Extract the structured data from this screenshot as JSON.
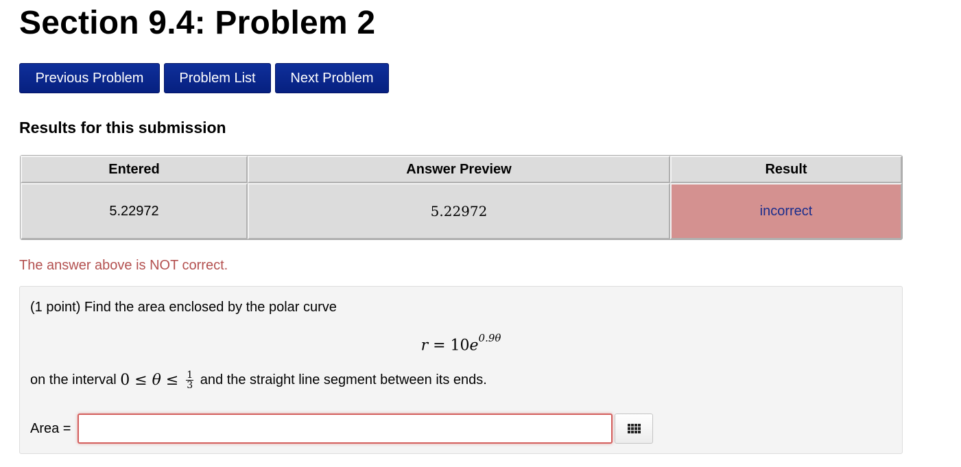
{
  "page": {
    "title": "Section 9.4: Problem 2"
  },
  "nav": {
    "previous_label": "Previous Problem",
    "list_label": "Problem List",
    "next_label": "Next Problem"
  },
  "results": {
    "heading": "Results for this submission",
    "columns": [
      "Entered",
      "Answer Preview",
      "Result"
    ],
    "row": {
      "entered": "5.22972",
      "preview": "5.22972",
      "result": "incorrect"
    },
    "feedback": "The answer above is NOT correct."
  },
  "problem": {
    "statement": "(1 point) Find the area enclosed by the polar curve",
    "equation": {
      "lhs": "r",
      "eq": " = ",
      "coef": "10",
      "base": "e",
      "exponent": "0.9θ"
    },
    "interval_prefix": "on the interval ",
    "interval_math_start": "0 ≤ ",
    "interval_var": "θ",
    "interval_math_mid": " ≤ ",
    "interval_frac_num": "1",
    "interval_frac_den": "3",
    "interval_suffix": " and the straight line segment between its ends.",
    "answer_label": "Area =",
    "answer_value": "",
    "keypad_icon": "keypad-grid-icon"
  },
  "colors": {
    "nav_button": "#062080",
    "table_bg": "#dcdcdc",
    "incorrect_bg": "#d49190",
    "incorrect_text": "#1a2d8c",
    "feedback_text": "#b3504f",
    "problem_bg": "#f4f4f4",
    "input_error_border": "#d45f5d"
  }
}
